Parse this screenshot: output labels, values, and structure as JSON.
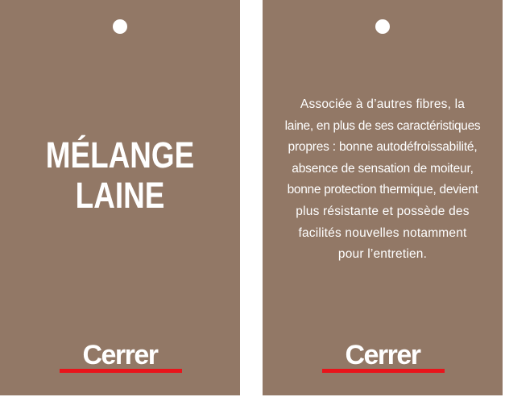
{
  "left_tag": {
    "title_lines": [
      "MÉLANGE",
      "LAINE"
    ],
    "brand": "Cerrer"
  },
  "right_tag": {
    "description_lines": [
      "Associée à d’autres fibres, la",
      "laine, en plus de ses caractéristiques",
      "propres : bonne autodéfroissabilité,",
      "absence de sensation de moiteur,",
      "bonne protection thermique, devient",
      "plus résistante et possède des",
      "facilités nouvelles notamment",
      "pour l’entretien."
    ],
    "brand": "Cerrer"
  },
  "colors": {
    "tag": "#927866",
    "brand_bar": "#e8141b",
    "text": "#ffffff"
  }
}
